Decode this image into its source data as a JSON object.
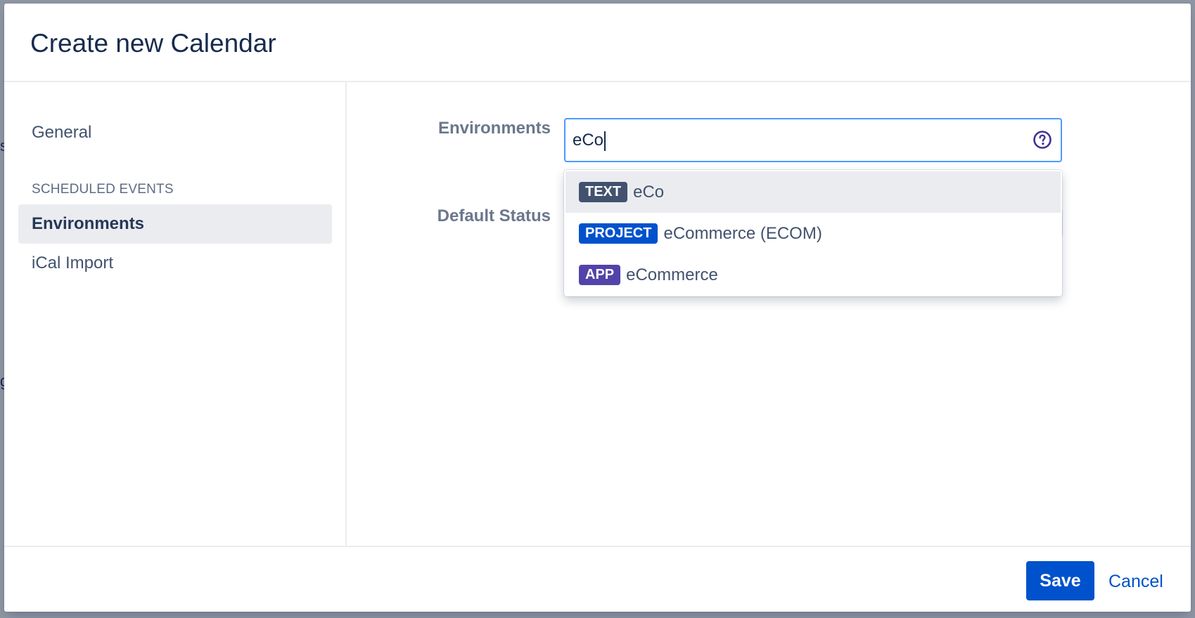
{
  "modal": {
    "title": "Create new Calendar"
  },
  "sidebar": {
    "general_label": "General",
    "section_heading": "SCHEDULED EVENTS",
    "items": [
      {
        "label": "Environments",
        "active": true
      },
      {
        "label": "iCal Import",
        "active": false
      }
    ]
  },
  "form": {
    "environments_label": "Environments",
    "environments_value": "eCo",
    "default_status_label": "Default Status",
    "help_icon": "question-circle-icon"
  },
  "dropdown": {
    "options": [
      {
        "tag": "TEXT",
        "tag_color": "#42526e",
        "text": "eCo",
        "highlighted": true
      },
      {
        "tag": "PROJECT",
        "tag_color": "#0052cc",
        "text": "eCommerce (ECOM)",
        "highlighted": false
      },
      {
        "tag": "APP",
        "tag_color": "#5243aa",
        "text": "eCommerce",
        "highlighted": false
      }
    ]
  },
  "footer": {
    "save_label": "Save",
    "cancel_label": "Cancel"
  },
  "colors": {
    "accent": "#0052cc",
    "focus_border": "#4c9aff",
    "selected_bg": "#ebecf0"
  }
}
